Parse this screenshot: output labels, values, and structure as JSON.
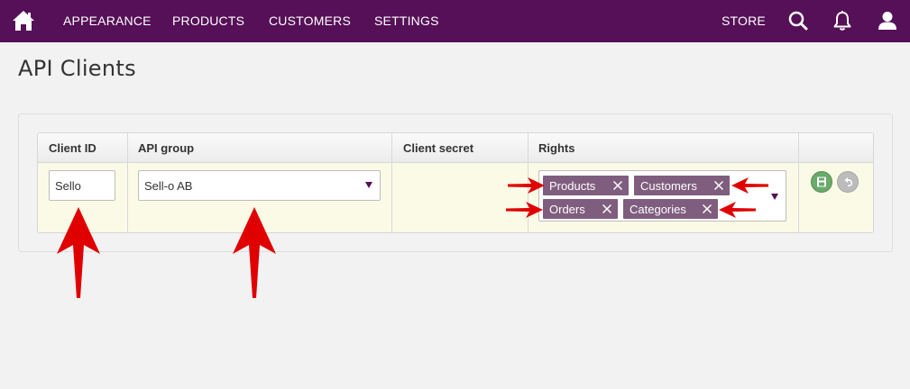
{
  "nav": {
    "items": [
      "APPEARANCE",
      "PRODUCTS",
      "CUSTOMERS",
      "SETTINGS"
    ],
    "store_label": "STORE",
    "icons": [
      "home-icon",
      "search-icon",
      "bell-icon",
      "user-icon"
    ],
    "bg_color": "#551057"
  },
  "page": {
    "title": "API Clients"
  },
  "table": {
    "headers": [
      "Client ID",
      "API group",
      "Client secret",
      "Rights"
    ],
    "row": {
      "client_id": "Sello",
      "api_group": "Sell-o AB",
      "client_secret": "",
      "rights": [
        "Products",
        "Customers",
        "Orders",
        "Categories"
      ]
    },
    "actions": [
      "save-icon",
      "undo-icon"
    ]
  },
  "colors": {
    "tag_bg": "#7f5d7e",
    "row_bg": "#fafae6",
    "annotation_arrow": "#e00000",
    "save_button": "#6aaa6a",
    "undo_button": "#bcbcbc"
  }
}
